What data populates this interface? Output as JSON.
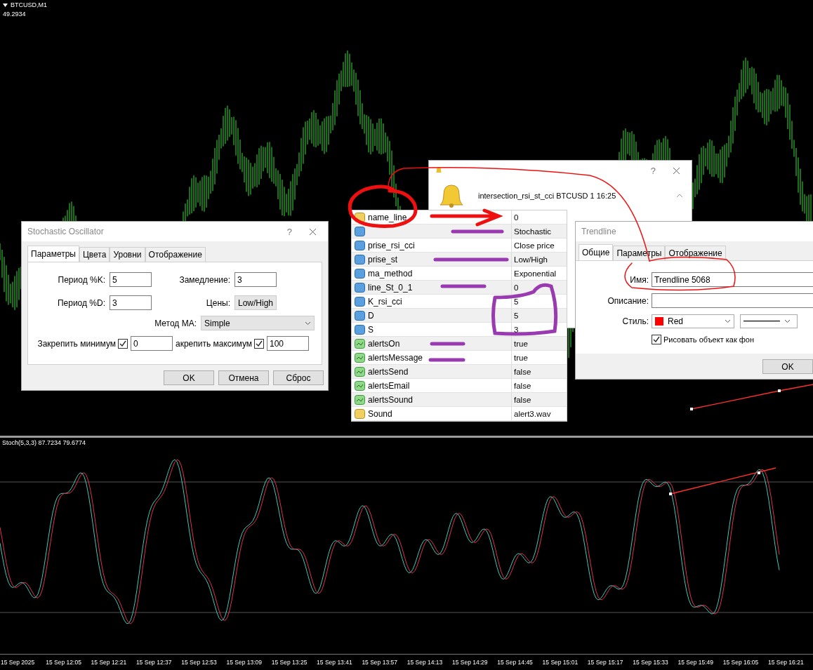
{
  "chart": {
    "symbol": "BTCUSD,M1",
    "value": "49.2934"
  },
  "indicator": {
    "label": "Stoch(5,3,3) 87.7234 79.6774"
  },
  "time_axis": [
    "15 Sep 2025",
    "15 Sep 12:05",
    "15 Sep 12:21",
    "15 Sep 12:37",
    "15 Sep 12:53",
    "15 Sep 13:09",
    "15 Sep 13:25",
    "15 Sep 13:41",
    "15 Sep 13:57",
    "15 Sep 14:13",
    "15 Sep 14:29",
    "15 Sep 14:45",
    "15 Sep 15:01",
    "15 Sep 15:17",
    "15 Sep 15:33",
    "15 Sep 15:49",
    "15 Sep 16:05",
    "15 Sep 16:21"
  ],
  "stochastic_dialog": {
    "title": "Stochastic Oscillator",
    "help": "?",
    "tabs": [
      {
        "label": "Параметры",
        "selected": true
      },
      {
        "label": "Цвета",
        "selected": false
      },
      {
        "label": "Уровни",
        "selected": false
      },
      {
        "label": "Отображение",
        "selected": false
      }
    ],
    "fields": [
      {
        "kind": "input",
        "label": "Период %K:",
        "value": "5"
      },
      {
        "kind": "input",
        "label": "Замедление:",
        "value": "3"
      },
      {
        "kind": "input",
        "label": "Период %D:",
        "value": "3"
      },
      {
        "kind": "select",
        "label": "Цены:",
        "value": "Low/High"
      }
    ],
    "ma_method": {
      "label": "Метод MA:",
      "value": "Simple"
    },
    "fix_rows": [
      {
        "label": "Закрепить минимум",
        "checked": true,
        "value": "0"
      },
      {
        "label": "акрепить максимум",
        "checked": true,
        "value": "100"
      }
    ],
    "buttons": [
      "OK",
      "Отмена",
      "Сброс"
    ]
  },
  "alert_dialog": {
    "help": "?",
    "message": "intersection_rsi_st_cci BTCUSD 1 16:25"
  },
  "inputs_table": [
    {
      "kind": "string",
      "name": "name_line",
      "value": "0"
    },
    {
      "kind": "int",
      "value": "Stochastic"
    },
    {
      "kind": "int",
      "name": "prise_rsi_cci",
      "value": "Close price"
    },
    {
      "kind": "int",
      "name": "prise_st",
      "value": "Low/High"
    },
    {
      "kind": "int",
      "name": "ma_method",
      "value": "Exponential"
    },
    {
      "kind": "int",
      "name": "line_St_0_1",
      "value": "0"
    },
    {
      "kind": "int",
      "name": "K_rsi_cci",
      "value": "5"
    },
    {
      "kind": "int",
      "name": "D",
      "value": "5"
    },
    {
      "kind": "int",
      "name": "S",
      "value": "3"
    },
    {
      "kind": "bool",
      "name": "alertsOn",
      "value": "true"
    },
    {
      "kind": "bool",
      "name": "alertsMessage",
      "value": "true"
    },
    {
      "kind": "bool",
      "name": "alertsSend",
      "value": "false"
    },
    {
      "kind": "bool",
      "name": "alertsEmail",
      "value": "false"
    },
    {
      "kind": "bool",
      "name": "alertsSound",
      "value": "false"
    },
    {
      "kind": "string",
      "name": "Sound",
      "value": "alert3.wav"
    }
  ],
  "trendline_dialog": {
    "title": "Trendline",
    "tabs": [
      {
        "label": "Общие",
        "selected": true
      },
      {
        "label": "Параметры",
        "selected": false
      },
      {
        "label": "Отображение",
        "selected": false
      }
    ],
    "name_label": "Имя:",
    "name_value": "Trendline 5068",
    "description_label": "Описание:",
    "style_label": "Стиль:",
    "style": {
      "color": "#ff0000",
      "color_name": "Red"
    },
    "background": {
      "label": "Рисовать объект как фон",
      "checked": true
    },
    "buttons": [
      "OK"
    ]
  }
}
